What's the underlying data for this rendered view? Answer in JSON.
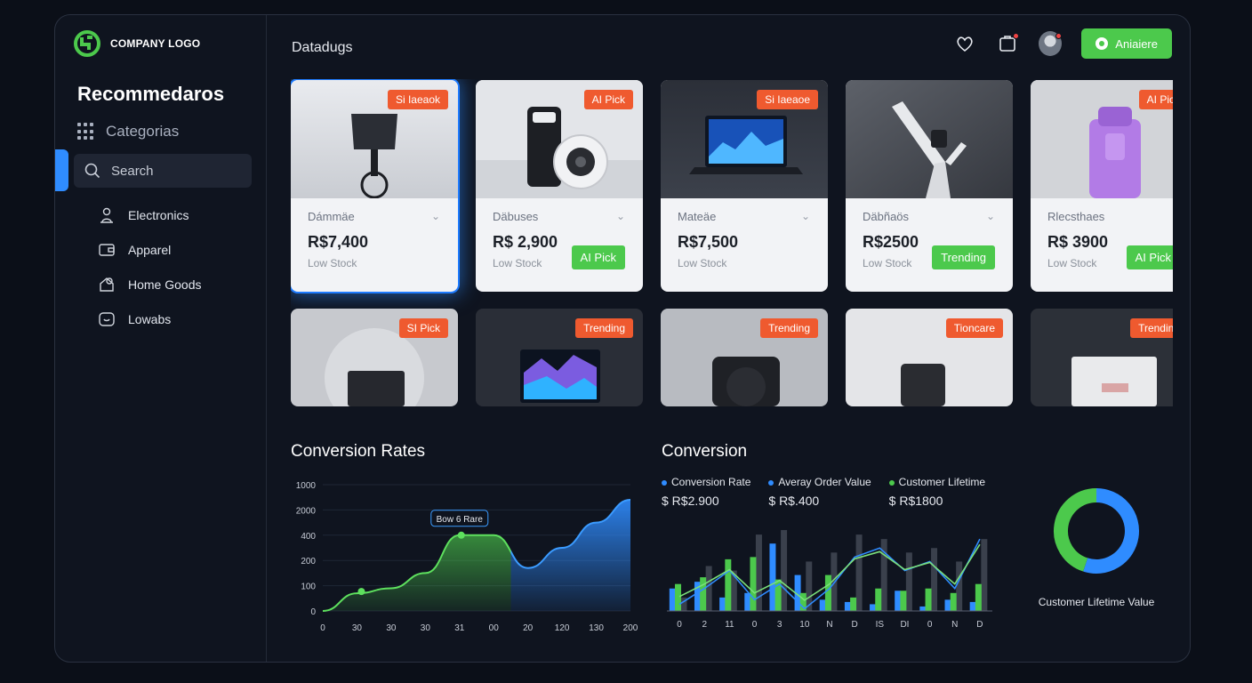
{
  "sidebar": {
    "logo_text": "COMPANY LOGO",
    "title": "Recommedaros",
    "categories_label": "Categorias",
    "search_placeholder": "Search",
    "items": [
      {
        "label": "Electronics",
        "icon": "person-icon"
      },
      {
        "label": "Apparel",
        "icon": "wallet-icon"
      },
      {
        "label": "Home Goods",
        "icon": "home-goods-icon"
      },
      {
        "label": "Lowabs",
        "icon": "chat-icon"
      }
    ]
  },
  "header": {
    "title": "Datadugs",
    "cta_label": "Aniaiere",
    "icons": [
      "heart-icon",
      "notification-icon",
      "avatar"
    ]
  },
  "products": [
    {
      "badge": "Si Iaeaok",
      "name": "Dámmäe",
      "price": "R$7,400",
      "stock": "Low Stock",
      "tag": ""
    },
    {
      "badge": "AI Pick",
      "name": "Däbuses",
      "price": "R$ 2,900",
      "stock": "Low Stock",
      "tag": "AI Pick"
    },
    {
      "badge": "Si Iaeaoe",
      "name": "Mateäe",
      "price": "R$7,500",
      "stock": "Low Stock",
      "tag": ""
    },
    {
      "badge": "",
      "name": "Däbñaös",
      "price": "R$2500",
      "stock": "Low Stock",
      "tag": "Trending"
    },
    {
      "badge": "AI Pick",
      "name": "Rlecsthaes",
      "price": "R$ 3900",
      "stock": "Low Stock",
      "tag": "AI Pick"
    }
  ],
  "products_row2": [
    {
      "badge": "SI Pick"
    },
    {
      "badge": "Trending"
    },
    {
      "badge": "Trending"
    },
    {
      "badge": "Tioncare"
    },
    {
      "badge": "Trending"
    }
  ],
  "conversion_rates": {
    "title": "Conversion Rates",
    "tooltip": "Bow 6 Rare"
  },
  "conversion": {
    "title": "Conversion",
    "legend": [
      {
        "label": "Conversion Rate",
        "value": "$ R$2.900",
        "color": "#2f8cff"
      },
      {
        "label": "Averay Order Value",
        "value": "$ R$.400",
        "color": "#2f8cff"
      },
      {
        "label": "Customer Lifetime",
        "value": "$ R$1800",
        "color": "#4cc94c"
      }
    ],
    "donut_label": "Customer Lifetime Value"
  },
  "chart_data": [
    {
      "type": "area",
      "title": "Conversion Rates",
      "x": [
        "0",
        "30",
        "30",
        "30",
        "31",
        "00",
        "20",
        "120",
        "130",
        "200"
      ],
      "yticks": [
        "0",
        "100",
        "200",
        "400",
        "2000",
        "1000"
      ],
      "series": [
        {
          "values": [
            0.0,
            0.7,
            0.9,
            1.5,
            3.0,
            3.0,
            1.7,
            2.5,
            3.5,
            4.4
          ]
        }
      ],
      "highlight_regions": [
        "green",
        "blue"
      ]
    },
    {
      "type": "bar",
      "title": "Conversion",
      "categories": [
        "0",
        "2",
        "11",
        "0",
        "3",
        "10",
        "N",
        "D",
        "IS",
        "DI",
        "0",
        "N",
        "D"
      ],
      "series": [
        {
          "name": "Conversion Rate",
          "color": "#2f8cff",
          "values": [
            1.0,
            1.3,
            0.6,
            0.8,
            3.0,
            1.6,
            0.5,
            0.4,
            0.3,
            0.9,
            0.2,
            0.5,
            0.4
          ]
        },
        {
          "name": "Averay Order Value",
          "color": "#4cc94c",
          "values": [
            1.2,
            1.5,
            2.3,
            2.4,
            1.4,
            0.8,
            1.6,
            0.6,
            1.0,
            0.9,
            1.0,
            0.8,
            1.2
          ]
        },
        {
          "name": "Customer Lifetime",
          "color": "#3a404c",
          "values": [
            0.6,
            2.0,
            1.8,
            3.4,
            3.6,
            2.2,
            2.6,
            3.4,
            3.2,
            2.6,
            2.8,
            2.2,
            3.2
          ]
        }
      ],
      "line": [
        0.3,
        1.0,
        1.8,
        0.5,
        1.2,
        0.1,
        1.0,
        2.4,
        2.8,
        1.8,
        2.2,
        1.0,
        3.2
      ]
    },
    {
      "type": "pie",
      "title": "Customer Lifetime Value",
      "slices": [
        {
          "color": "#2f8cff",
          "value": 55
        },
        {
          "color": "#4cc94c",
          "value": 45
        }
      ]
    }
  ]
}
